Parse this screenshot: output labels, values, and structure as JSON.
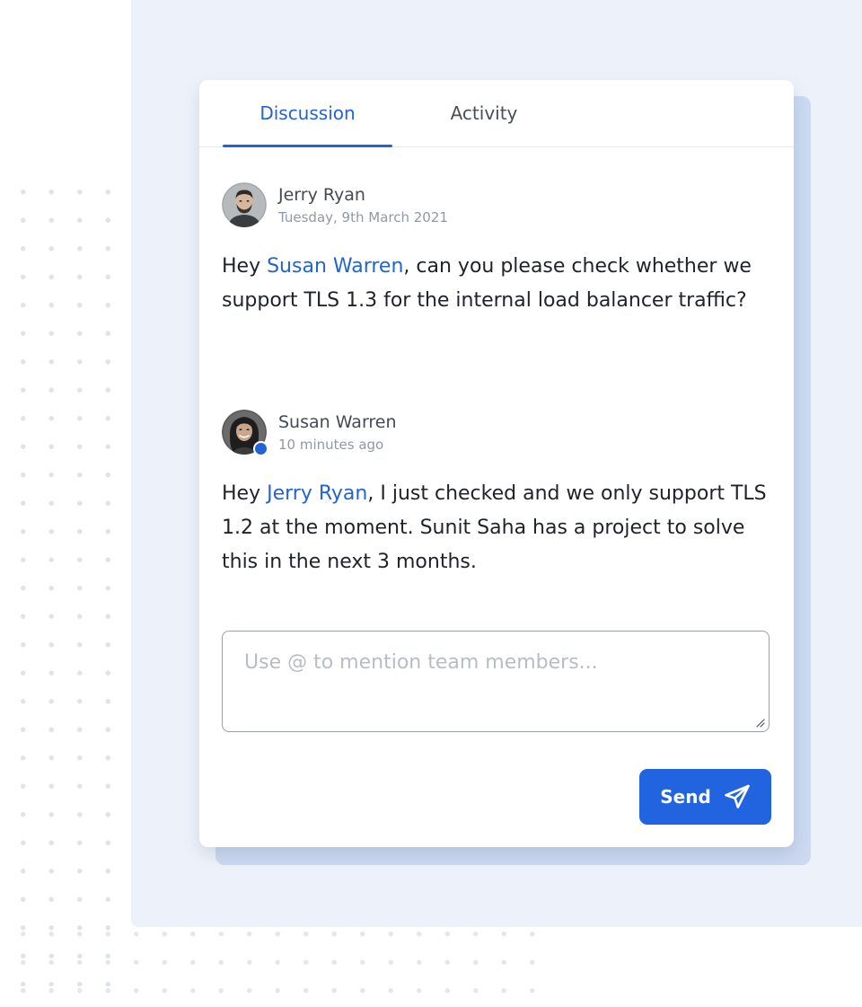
{
  "tabs": [
    {
      "label": "Discussion",
      "active": true
    },
    {
      "label": "Activity",
      "active": false
    }
  ],
  "messages": [
    {
      "author": "Jerry Ryan",
      "time": "Tuesday, 9th March 2021",
      "body": {
        "pre": "Hey ",
        "mention": "Susan Warren",
        "post": ", can you please check whether we support TLS 1.3 for the internal load balancer traffic?"
      },
      "online": false
    },
    {
      "author": "Susan Warren",
      "time": "10 minutes ago",
      "body": {
        "pre": "Hey ",
        "mention": "Jerry Ryan",
        "post": ", I just checked and we only support TLS 1.2 at the moment. Sunit Saha has a project to solve this in the next 3 months."
      },
      "online": true
    }
  ],
  "composer": {
    "placeholder": "Use @ to mention team members...",
    "value": ""
  },
  "send_button": {
    "label": "Send",
    "icon": "paper-plane-icon"
  },
  "colors": {
    "accent": "#2264d1",
    "background_panel": "#edf2fa",
    "card_shadow": "#ccd9f1"
  }
}
